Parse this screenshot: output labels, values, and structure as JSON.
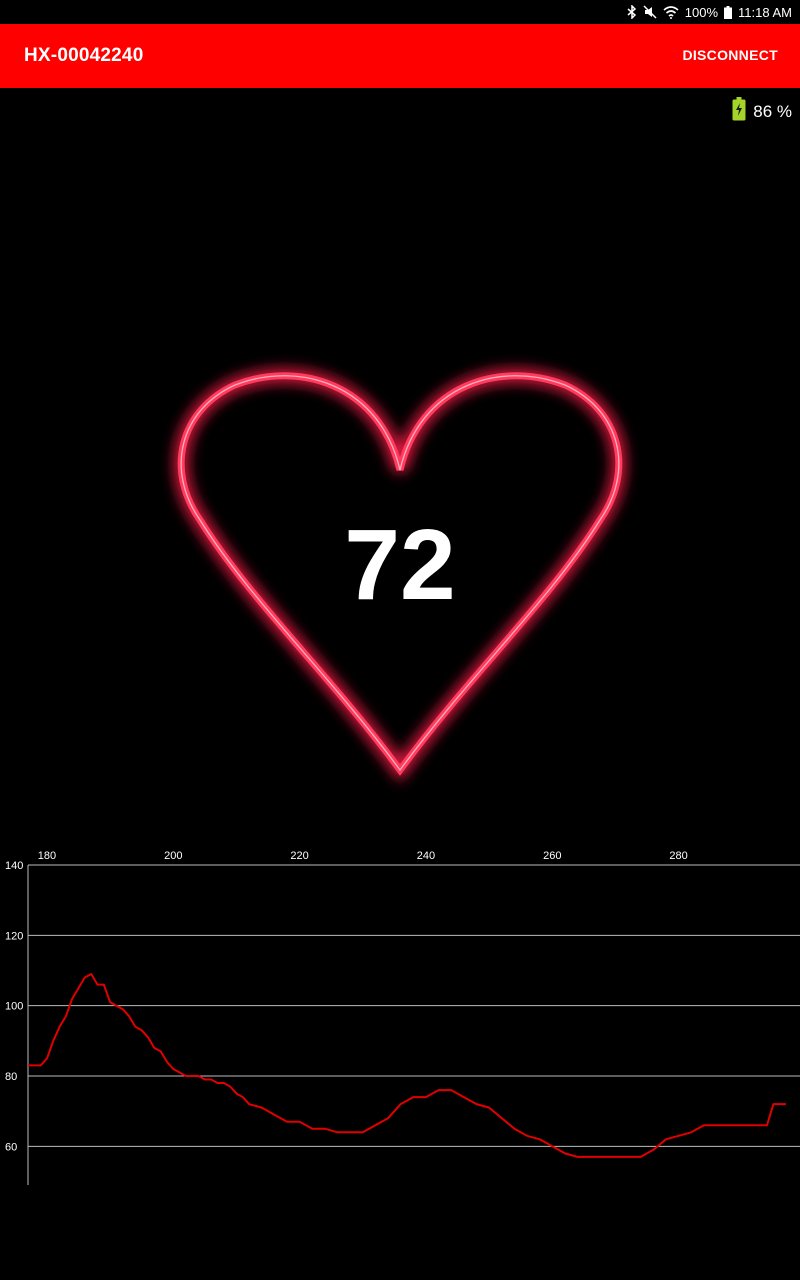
{
  "status_bar": {
    "battery_percent": "100%",
    "time": "11:18 AM",
    "icons": [
      "bluetooth-icon",
      "mute-icon",
      "wifi-icon",
      "battery-icon"
    ]
  },
  "app_bar": {
    "title": "HX-00042240",
    "disconnect_label": "DISCONNECT",
    "background": "#ff0000"
  },
  "device_battery": {
    "value": "86 %",
    "icon": "battery-charging-icon",
    "icon_color": "#a4d42a"
  },
  "heart_rate": {
    "value": "72",
    "icon": "heart-outline-icon",
    "color": "#ff2a4d"
  },
  "chart_data": {
    "type": "line",
    "title": "",
    "xlabel": "",
    "ylabel": "",
    "x_ticks": [
      "180",
      "200",
      "220",
      "240",
      "260",
      "280"
    ],
    "y_ticks": [
      "140",
      "120",
      "100",
      "80",
      "60"
    ],
    "xlim": [
      177,
      297
    ],
    "ylim": [
      49,
      140
    ],
    "grid": "horizontal",
    "series_color": "#e00000",
    "series": [
      {
        "x": [
          177,
          179,
          180,
          181,
          182,
          183,
          184,
          185,
          186,
          187,
          188,
          189,
          190,
          191,
          192,
          193,
          194,
          195,
          196,
          197,
          198,
          199,
          200,
          201,
          202,
          203,
          204,
          205,
          206,
          207,
          208,
          209,
          210,
          211,
          212,
          214,
          216,
          218,
          220,
          222,
          224,
          226,
          228,
          230,
          232,
          234,
          236,
          238,
          240,
          242,
          244,
          246,
          248,
          250,
          252,
          254,
          256,
          258,
          260,
          262,
          264,
          266,
          268,
          270,
          272,
          274,
          276,
          278,
          280,
          282,
          284,
          286,
          288,
          290,
          292,
          294,
          295,
          297
        ],
        "y": [
          83,
          83,
          85,
          90,
          94,
          97,
          102,
          105,
          108,
          109,
          106,
          106,
          101,
          100,
          99,
          97,
          94,
          93,
          91,
          88,
          87,
          84,
          82,
          81,
          80,
          80,
          80,
          79,
          79,
          78,
          78,
          77,
          75,
          74,
          72,
          71,
          69,
          67,
          67,
          65,
          65,
          64,
          64,
          64,
          66,
          68,
          72,
          74,
          74,
          76,
          76,
          74,
          72,
          71,
          68,
          65,
          63,
          62,
          60,
          58,
          57,
          57,
          57,
          57,
          57,
          57,
          59,
          62,
          63,
          64,
          66,
          66,
          66,
          66,
          66,
          66,
          72,
          72
        ]
      }
    ]
  }
}
